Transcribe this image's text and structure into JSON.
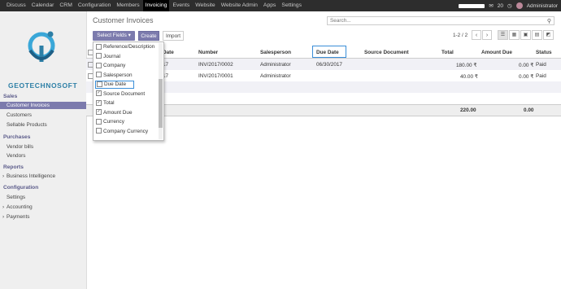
{
  "topbar": {
    "menu": [
      "Discuss",
      "Calendar",
      "CRM",
      "Configuration",
      "Members",
      "Invoicing",
      "Events",
      "Website",
      "Website Admin",
      "Apps",
      "Settings"
    ],
    "active": "Invoicing",
    "notif_count": "20",
    "user": "Administrator"
  },
  "logo": {
    "text": "GEOTECHNOSOFT"
  },
  "sidebar": {
    "sales": "Sales",
    "sales_items": [
      "Customer Invoices",
      "Customers",
      "Sellable Products"
    ],
    "purchases": "Purchases",
    "purchase_items": [
      "Vendor bills",
      "Vendors"
    ],
    "reports": "Reports",
    "report_items": [
      "Business Intelligence"
    ],
    "configuration": "Configuration",
    "config_items": [
      "Settings",
      "Accounting",
      "Payments"
    ]
  },
  "control": {
    "title": "Customer Invoices",
    "search_placeholder": "Search...",
    "select_fields": "Select Fields ▾",
    "create": "Create",
    "import": "Import",
    "pager": "1-2 / 2"
  },
  "table": {
    "headers": [
      "Date",
      "Number",
      "Salesperson",
      "Due Date",
      "Source Document",
      "Total",
      "Amount Due",
      "Status"
    ],
    "rows": [
      {
        "date": "17",
        "number": "INV/2017/0002",
        "salesperson": "Administrator",
        "due": "06/30/2017",
        "source": "",
        "total": "180.00 ₹",
        "amount_due": "0.00 ₹",
        "status": "Paid"
      },
      {
        "date": "17",
        "number": "INV/2017/0001",
        "salesperson": "Administrator",
        "due": "",
        "source": "",
        "total": "40.00 ₹",
        "amount_due": "0.00 ₹",
        "status": "Paid"
      }
    ],
    "footer_total": "220.00",
    "footer_due": "0.00"
  },
  "dropdown": {
    "items": [
      {
        "label": "Reference/Description",
        "checked": false
      },
      {
        "label": "Journal",
        "checked": false
      },
      {
        "label": "Company",
        "checked": false
      },
      {
        "label": "Salesperson",
        "checked": false
      },
      {
        "label": "Due Date",
        "checked": false
      },
      {
        "label": "Source Document",
        "checked": true
      },
      {
        "label": "Total",
        "checked": true
      },
      {
        "label": "Amount Due",
        "checked": true
      },
      {
        "label": "Currency",
        "checked": false
      },
      {
        "label": "Company Currency",
        "checked": false
      }
    ]
  },
  "colors": {
    "accent": "#7c7bad",
    "highlight": "#3a8ed8"
  }
}
